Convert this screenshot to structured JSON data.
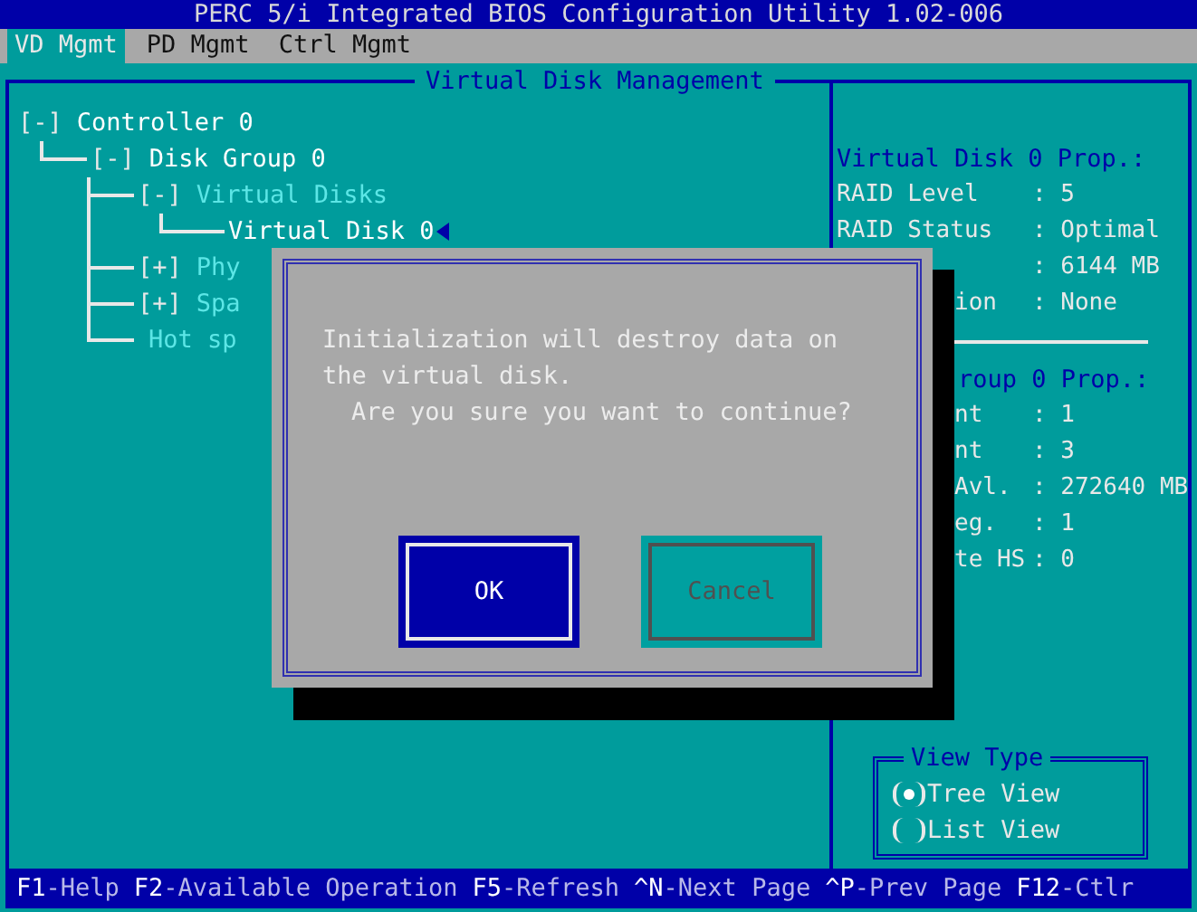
{
  "window": {
    "title": "PERC 5/i Integrated BIOS Configuration Utility 1.02-006"
  },
  "tabs": [
    {
      "label": "VD Mgmt",
      "selected": true
    },
    {
      "label": "PD Mgmt",
      "selected": false
    },
    {
      "label": "Ctrl Mgmt",
      "selected": false
    }
  ],
  "panel_title": "Virtual Disk Management",
  "tree": [
    {
      "toggle": "[-]",
      "label": "Controller 0",
      "color": "#ffffff",
      "selected": false,
      "children": [
        {
          "toggle": "[-]",
          "label": "Disk Group 0",
          "color": "#ffffff",
          "selected": false,
          "children": [
            {
              "toggle": "[-]",
              "label": "Virtual Disks",
              "color": "#5ce6e6",
              "selected": false,
              "children": [
                {
                  "label": "Virtual Disk 0",
                  "color": "#ffffff",
                  "selected": true
                }
              ]
            },
            {
              "toggle": "[+]",
              "label": "Phy",
              "color": "#5ce6e6",
              "selected": false
            },
            {
              "toggle": "[+]",
              "label": "Spa",
              "color": "#5ce6e6",
              "selected": false
            },
            {
              "label": "Hot sp",
              "color": "#5ce6e6",
              "selected": false
            }
          ]
        }
      ]
    }
  ],
  "vd_props": {
    "title": "Virtual Disk 0 Prop.:",
    "rows": [
      {
        "kind": "full",
        "label": "RAID Level",
        "value": ": 5"
      },
      {
        "kind": "full",
        "label": "RAID Status",
        "value": ": Optimal"
      },
      {
        "kind": "clipped",
        "value": ": 6144 MB"
      },
      {
        "kind": "clipped",
        "label": "ion",
        "value": ": None"
      }
    ]
  },
  "dg_props": {
    "title": "roup 0 Prop.:",
    "rows": [
      {
        "kind": "clipped",
        "label": "nt",
        "value": ": 1"
      },
      {
        "kind": "clipped",
        "label": "nt",
        "value": ": 3"
      },
      {
        "kind": "clipped",
        "label": "Avl.",
        "value": ": 272640 MB"
      },
      {
        "kind": "clipped",
        "label": "eg.",
        "value": ": 1"
      },
      {
        "kind": "clipped",
        "label": "te HS",
        "value": ": 0"
      }
    ]
  },
  "view_type": {
    "title": "View Type",
    "options": [
      {
        "label": "Tree View",
        "selected": true
      },
      {
        "label": "List View",
        "selected": false
      }
    ]
  },
  "dialog": {
    "message": [
      "Initialization will destroy data on",
      "the virtual disk."
    ],
    "question": "Are you sure you want to continue?",
    "buttons": [
      {
        "label": "OK",
        "selected": true
      },
      {
        "label": "Cancel",
        "selected": false
      }
    ]
  },
  "status_bar": [
    {
      "key": "F1",
      "label": "-Help"
    },
    {
      "key": "F2",
      "label": "-Available Operation"
    },
    {
      "key": "F5",
      "label": "-Refresh"
    },
    {
      "key": "^N",
      "label": "-Next Page"
    },
    {
      "key": "^P",
      "label": "-Prev Page"
    },
    {
      "key": "F12",
      "label": "-Ctlr"
    }
  ]
}
